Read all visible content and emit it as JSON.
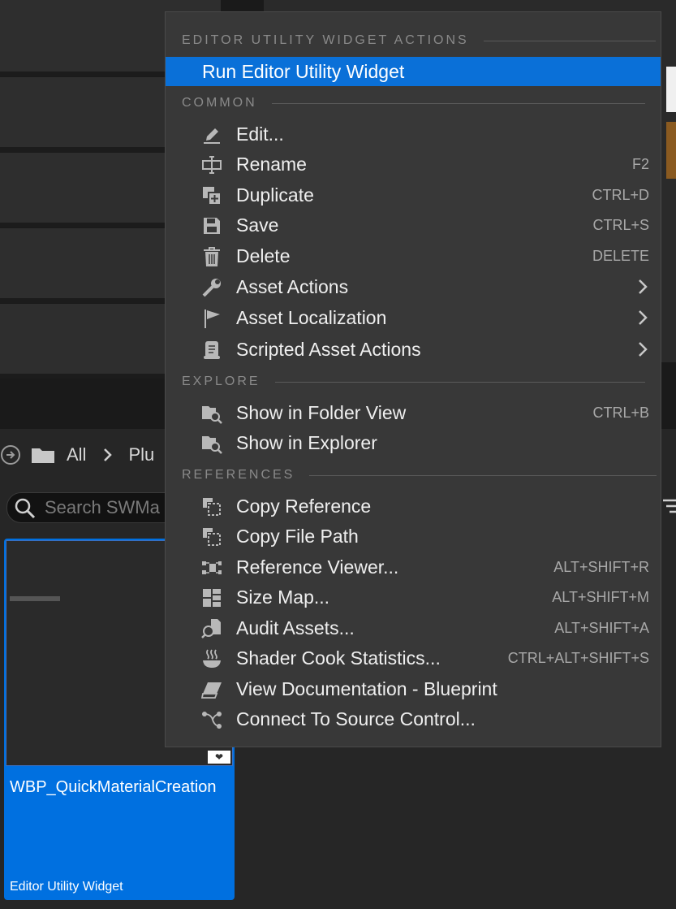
{
  "menu": {
    "sections": {
      "widget_actions": "EDITOR UTILITY WIDGET ACTIONS",
      "common": "COMMON",
      "explore": "EXPLORE",
      "references": "REFERENCES"
    },
    "run_widget": "Run Editor Utility Widget",
    "items": [
      {
        "label": "Edit...",
        "shortcut": "",
        "icon": "pencil-icon"
      },
      {
        "label": "Rename",
        "shortcut": "F2",
        "icon": "rename-icon"
      },
      {
        "label": "Duplicate",
        "shortcut": "CTRL+D",
        "icon": "duplicate-icon"
      },
      {
        "label": "Save",
        "shortcut": "CTRL+S",
        "icon": "save-icon"
      },
      {
        "label": "Delete",
        "shortcut": "DELETE",
        "icon": "trash-icon"
      },
      {
        "label": "Asset Actions",
        "shortcut": "",
        "icon": "wrench-icon",
        "submenu": true
      },
      {
        "label": "Asset Localization",
        "shortcut": "",
        "icon": "flag-icon",
        "submenu": true
      },
      {
        "label": "Scripted Asset Actions",
        "shortcut": "",
        "icon": "scroll-icon",
        "submenu": true
      },
      {
        "label": "Show in Folder View",
        "shortcut": "CTRL+B",
        "icon": "folder-search-icon"
      },
      {
        "label": "Show in Explorer",
        "shortcut": "",
        "icon": "folder-search-icon"
      },
      {
        "label": "Copy Reference",
        "shortcut": "",
        "icon": "copy-reference-icon"
      },
      {
        "label": "Copy File Path",
        "shortcut": "",
        "icon": "copy-path-icon"
      },
      {
        "label": "Reference Viewer...",
        "shortcut": "ALT+SHIFT+R",
        "icon": "reference-viewer-icon"
      },
      {
        "label": "Size Map...",
        "shortcut": "ALT+SHIFT+M",
        "icon": "size-map-icon"
      },
      {
        "label": "Audit Assets...",
        "shortcut": "ALT+SHIFT+A",
        "icon": "audit-icon"
      },
      {
        "label": "Shader Cook Statistics...",
        "shortcut": "CTRL+ALT+SHIFT+S",
        "icon": "shader-stats-icon"
      },
      {
        "label": "View Documentation - Blueprint",
        "shortcut": "",
        "icon": "documentation-icon"
      },
      {
        "label": "Connect To Source Control...",
        "shortcut": "",
        "icon": "source-control-icon"
      }
    ]
  },
  "breadcrumb": {
    "all": "All",
    "next": "Plu"
  },
  "search": {
    "placeholder": "Search SWMa"
  },
  "asset": {
    "name": "WBP_QuickMaterialCreation",
    "type": "Editor Utility Widget"
  },
  "colors": {
    "highlight": "#0a70d8",
    "menu_bg": "#383838",
    "tile": "#0070e0"
  }
}
